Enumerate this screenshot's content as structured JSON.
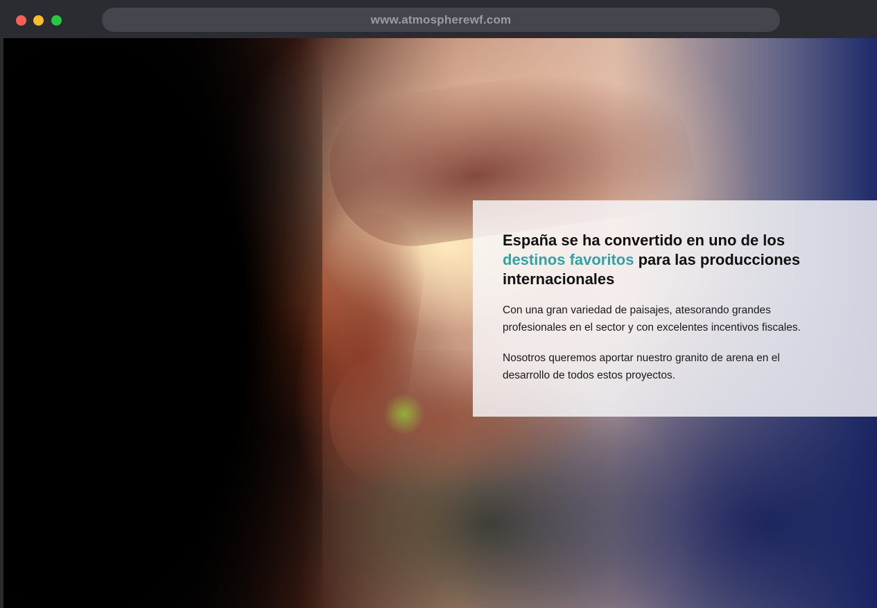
{
  "browser": {
    "url": "www.atmospherewf.com"
  },
  "hero": {
    "image_description_icon": "sunset-hands-frame-photo"
  },
  "card": {
    "title_part1": "España se ha convertido en uno de los ",
    "title_accent": "destinos favoritos",
    "title_part2": " para las producciones internacionales",
    "paragraph1": "Con una gran variedad de paisajes, atesorando grandes profesionales en el sector y con excelentes incentivos fiscales.",
    "paragraph2": "Nosotros queremos aportar nuestro granito de arena en el desarrollo de todos estos proyectos."
  },
  "colors": {
    "accent": "#2fa3a6",
    "close": "#fe5f57",
    "minimize": "#febc2e",
    "maximize": "#28c840"
  }
}
